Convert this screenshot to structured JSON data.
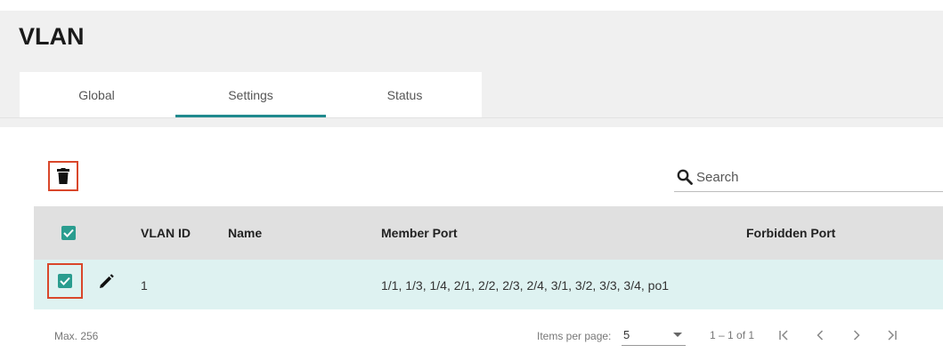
{
  "page": {
    "title": "VLAN"
  },
  "tabs": [
    {
      "label": "Global",
      "active": false
    },
    {
      "label": "Settings",
      "active": true
    },
    {
      "label": "Status",
      "active": false
    }
  ],
  "toolbar": {
    "delete_icon": "trash-icon"
  },
  "search": {
    "icon": "search-icon",
    "placeholder": "Search",
    "value": ""
  },
  "table": {
    "columns": [
      "VLAN ID",
      "Name",
      "Member Port",
      "Forbidden Port"
    ],
    "header_checked": true,
    "rows": [
      {
        "checked": true,
        "edit_icon": "pencil-icon",
        "vlan_id": "1",
        "name": "",
        "member_port": "1/1, 1/3, 1/4, 2/1, 2/2, 2/3, 2/4, 3/1, 3/2, 3/3, 3/4, po1",
        "forbidden_port": ""
      }
    ]
  },
  "footer": {
    "max_label": "Max. 256",
    "items_per_page_label": "Items per page:",
    "items_per_page_value": "5",
    "range_label": "1 – 1 of 1",
    "nav_icons": [
      "first-page-icon",
      "prev-page-icon",
      "next-page-icon",
      "last-page-icon"
    ]
  },
  "colors": {
    "accent": "#1f8a8e",
    "checkbox": "#2a9d8f",
    "highlight_frame": "#d9472b",
    "selected_row": "#def2f1",
    "header_bg": "#e0e0e0"
  }
}
